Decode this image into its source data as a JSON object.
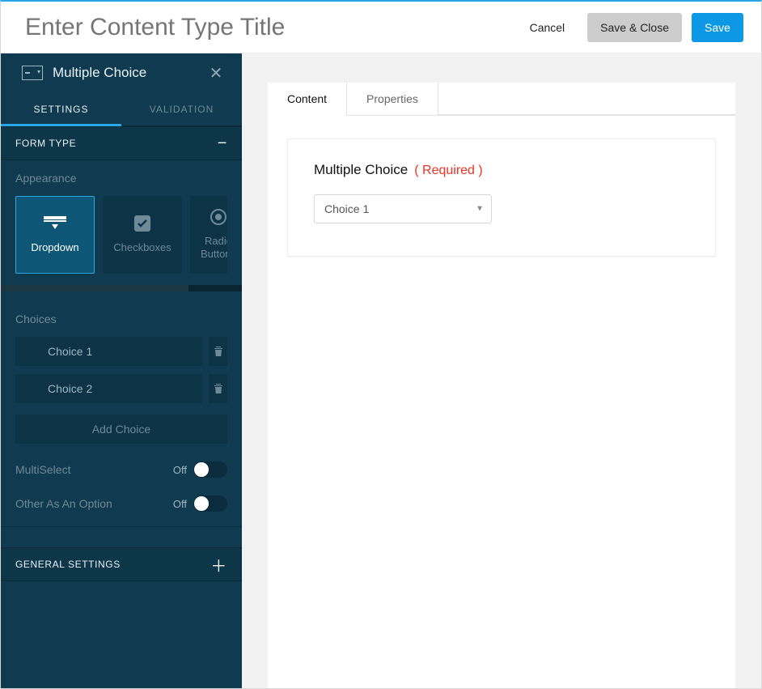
{
  "header": {
    "title_placeholder": "Enter Content Type Title",
    "cancel": "Cancel",
    "save_close": "Save & Close",
    "save": "Save"
  },
  "sidebar": {
    "title": "Multiple Choice",
    "tabs": {
      "settings": "SETTINGS",
      "validation": "VALIDATION"
    },
    "form_type": {
      "heading": "FORM TYPE",
      "appearance_label": "Appearance",
      "options": {
        "dropdown": "Dropdown",
        "checkboxes": "Checkboxes",
        "radio": "Radio Buttons"
      },
      "choices_label": "Choices",
      "choices": [
        "Choice 1",
        "Choice 2"
      ],
      "add_choice": "Add Choice",
      "multiselect_label": "MultiSelect",
      "multiselect_state": "Off",
      "other_label": "Other As An Option",
      "other_state": "Off"
    },
    "general_settings": "GENERAL SETTINGS"
  },
  "main": {
    "tabs": {
      "content": "Content",
      "properties": "Properties"
    },
    "field_title": "Multiple Choice",
    "required": "( Required )",
    "select_value": "Choice 1"
  }
}
